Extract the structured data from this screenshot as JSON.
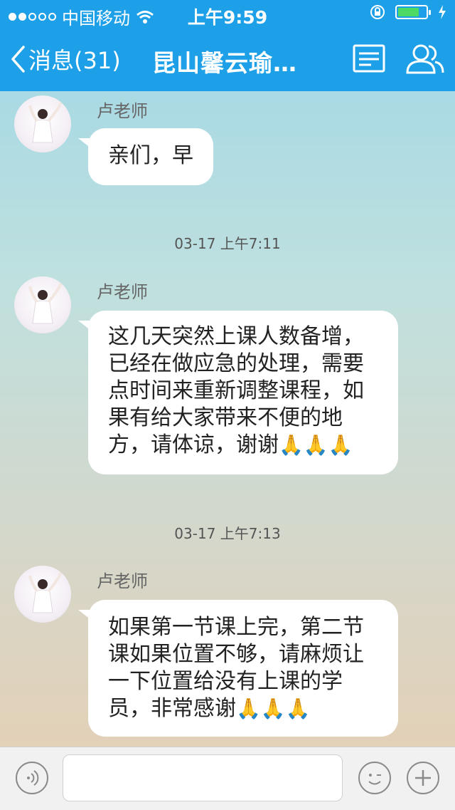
{
  "status_bar": {
    "carrier": "中国移动",
    "time": "上午9:59"
  },
  "nav": {
    "back_label": "消息(31)",
    "title": "昆山馨云瑜…"
  },
  "messages": [
    {
      "sender": "卢老师",
      "text": "亲们，早"
    },
    {
      "timestamp": "03-17 上午7:11",
      "sender": "卢老师",
      "lines": [
        "这几天突然上课人数备增，",
        "已经在做应急的处理，需要",
        "点时间来重新调整课程，如",
        "果有给大家带来不便的地",
        "方，请体谅，谢谢"
      ],
      "emoji": "🙏🙏🙏"
    },
    {
      "timestamp": "03-17 上午7:13",
      "sender": "卢老师",
      "lines": [
        "如果第一节课上完，第二节",
        "课如果位置不够，请麻烦让",
        "一下位置给没有上课的学",
        "员，非常感谢"
      ],
      "emoji": "🙏🙏🙏"
    }
  ],
  "input": {
    "placeholder": ""
  },
  "icons": {
    "voice": "voice-icon",
    "emoji": "emoji-icon",
    "plus": "plus-icon",
    "menu": "menu-icon",
    "group": "group-members-icon",
    "back": "chevron-left-icon"
  },
  "colors": {
    "nav": "#1ea0e8",
    "bubble": "#ffffff",
    "battery": "#4cd964"
  }
}
